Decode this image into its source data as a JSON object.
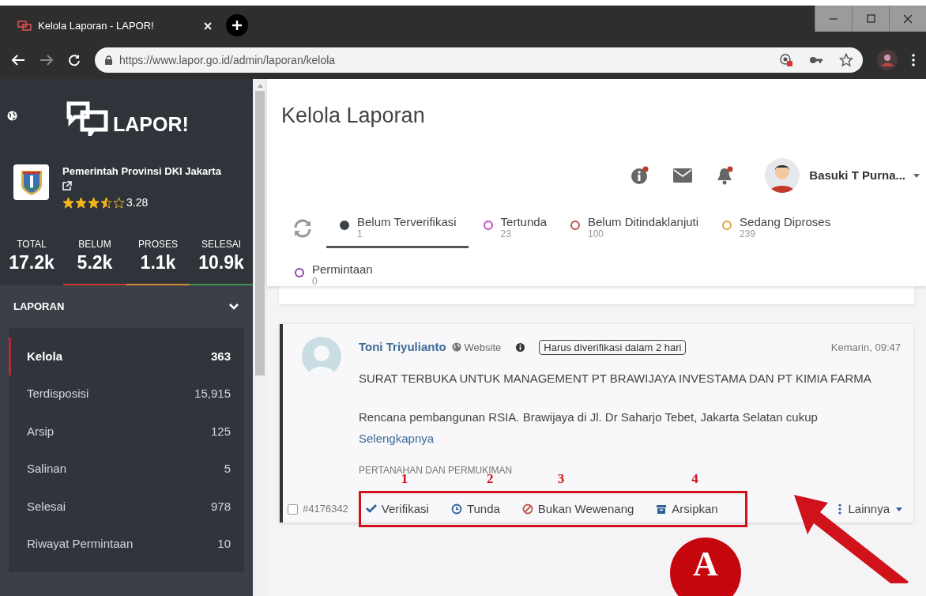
{
  "browser": {
    "tab_title": "Kelola Laporan - LAPOR!",
    "url": "https://www.lapor.go.id/admin/laporan/kelola"
  },
  "sidebar": {
    "logo_text": "LAPOR!",
    "org_name": "Pemerintah Provinsi DKI Jakarta",
    "stars": 3.5,
    "rating": "3.28",
    "stats": [
      {
        "label": "TOTAL",
        "value": "17.2k"
      },
      {
        "label": "BELUM",
        "value": "5.2k",
        "color": "#c0392b"
      },
      {
        "label": "PROSES",
        "value": "1.1k",
        "color": "#d68a2e"
      },
      {
        "label": "SELESAI",
        "value": "10.9k",
        "color": "#3f8f4a"
      }
    ],
    "section": {
      "title": "LAPORAN",
      "expanded": true
    },
    "items": [
      {
        "label": "Kelola",
        "count": "363",
        "selected": true
      },
      {
        "label": "Terdisposisi",
        "count": "15,915",
        "selected": false
      },
      {
        "label": "Arsip",
        "count": "125",
        "selected": false
      },
      {
        "label": "Salinan",
        "count": "5",
        "selected": false
      },
      {
        "label": "Selesai",
        "count": "978",
        "selected": false
      },
      {
        "label": "Riwayat Permintaan",
        "count": "10",
        "selected": false
      }
    ]
  },
  "page_title": "Kelola Laporan",
  "user": {
    "name": "Basuki T Purna..."
  },
  "tabs": [
    {
      "label": "Belum Terverifikasi",
      "count": "1",
      "color": "#3b4049",
      "selected": true
    },
    {
      "label": "Tertunda",
      "count": "23",
      "color": "#c74bc7",
      "selected": false
    },
    {
      "label": "Belum Ditindaklanjuti",
      "count": "100",
      "color": "#c0504d",
      "selected": false
    },
    {
      "label": "Sedang Diproses",
      "count": "239",
      "color": "#d9a441",
      "selected": false
    },
    {
      "label": "Permintaan",
      "count": "0",
      "color": "#8e44ad",
      "selected": false
    }
  ],
  "report": {
    "author": "Toni Triyulianto",
    "source": "Website",
    "deadline": "Harus diverifikasi dalam 2 hari",
    "time": "Kemarin, 09:47",
    "title": "SURAT TERBUKA UNTUK MANAGEMENT PT BRAWIJAYA INVESTAMA DAN PT KIMIA FARMA",
    "excerpt": "Rencana pembangunan RSIA. Brawijaya di Jl. Dr Saharjo Tebet, Jakarta Selatan cukup",
    "more": "Selengkapnya",
    "category": "PERTANAHAN DAN PERMUKIMAN",
    "id": "#4176342",
    "checked": false,
    "actions": [
      {
        "kind": "verify",
        "label": "Verifikasi",
        "marker": "1"
      },
      {
        "kind": "delay",
        "label": "Tunda",
        "marker": "2"
      },
      {
        "kind": "reject",
        "label": "Bukan Wewenang",
        "marker": "3"
      },
      {
        "kind": "archive",
        "label": "Arsipkan",
        "marker": "4"
      }
    ],
    "more_menu": "Lainnya"
  },
  "annotation": {
    "badge": "A"
  }
}
